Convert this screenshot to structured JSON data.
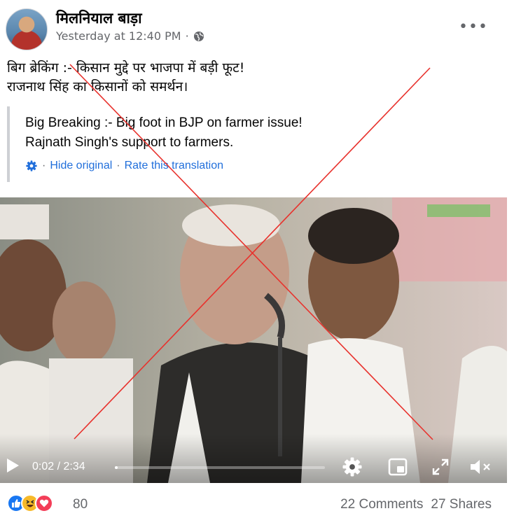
{
  "post": {
    "page_name": "मिलनियाल बाड़ा",
    "timestamp": "Yesterday at 12:40 PM",
    "meta_separator": "·",
    "audience_icon": "globe-icon",
    "more_label": "•••",
    "text_line1": "बिग ब्रेकिंग :- किसान मुद्दे पर भाजपा में बड़ी फूट!",
    "text_line2": "राजनाथ सिंह का किसानों को समर्थन।"
  },
  "translation": {
    "line1": "Big Breaking :- Big foot in BJP on farmer issue!",
    "line2": "Rajnath Singh's support to farmers.",
    "hide_label": "Hide original",
    "rate_label": "Rate this translation",
    "separator": "·"
  },
  "video": {
    "current_time": "0:02",
    "duration": "2:34",
    "time_separator": " / ",
    "progress_fraction": 0.013,
    "icons": [
      "play-icon",
      "settings-icon",
      "pip-icon",
      "fullscreen-icon",
      "mute-icon"
    ]
  },
  "overlay": {
    "color": "#e8322d"
  },
  "engagement": {
    "reaction_icons": [
      "like-icon",
      "haha-icon",
      "love-icon"
    ],
    "reaction_count": "80",
    "comments": "22 Comments",
    "shares": "27 Shares"
  },
  "colors": {
    "link_blue": "#216fdb",
    "secondary_text": "#65676b",
    "like_blue": "#1877f2",
    "haha_yellow": "#f7b928",
    "love_red": "#f33e58"
  }
}
